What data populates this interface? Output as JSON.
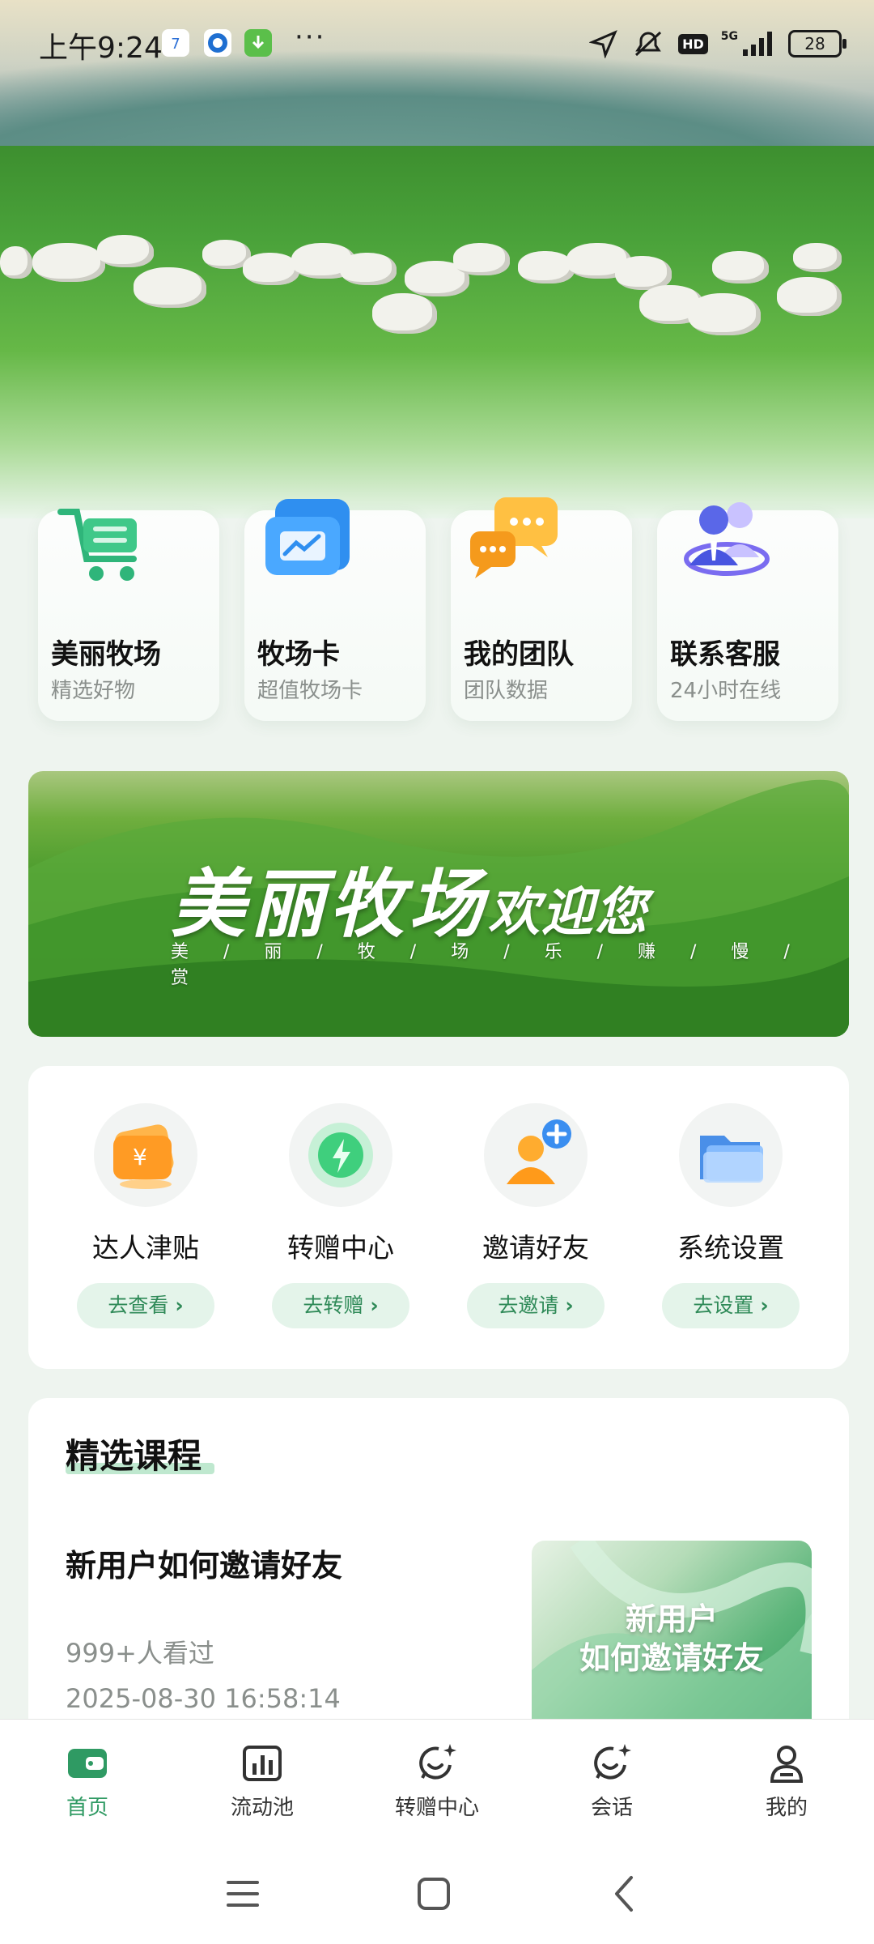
{
  "status_bar": {
    "time": "上午9:24",
    "network": "5G",
    "hd": "HD",
    "battery": "28",
    "more": "···"
  },
  "quick_entries": [
    {
      "title": "美丽牧场",
      "subtitle": "精选好物",
      "icon": "shopping-cart-icon"
    },
    {
      "title": "牧场卡",
      "subtitle": "超值牧场卡",
      "icon": "chart-card-icon"
    },
    {
      "title": "我的团队",
      "subtitle": "团队数据",
      "icon": "chat-bubbles-icon"
    },
    {
      "title": "联系客服",
      "subtitle": "24小时在线",
      "icon": "customer-service-icon"
    }
  ],
  "banner": {
    "headline": "美丽牧场",
    "headline_suffix": "欢迎您",
    "tagline": "美 / 丽 / 牧 / 场 / 乐 / 赚 / 慢 / 赏"
  },
  "tools": [
    {
      "label": "达人津贴",
      "action": "去查看",
      "icon": "wallet-coin-icon"
    },
    {
      "label": "转赠中心",
      "action": "去转赠",
      "icon": "lightning-icon"
    },
    {
      "label": "邀请好友",
      "action": "去邀请",
      "icon": "add-user-icon"
    },
    {
      "label": "系统设置",
      "action": "去设置",
      "icon": "folder-icon"
    }
  ],
  "courses": {
    "section_title": "精选课程",
    "items": [
      {
        "title": "新用户如何邀请好友",
        "views": "999+人看过",
        "date": "2025-08-30 16:58:14",
        "thumb_line1": "新用户",
        "thumb_line2": "如何邀请好友"
      }
    ]
  },
  "tabbar": {
    "active": "首页",
    "items": [
      {
        "label": "首页",
        "icon": "wallet-home-icon"
      },
      {
        "label": "流动池",
        "icon": "bar-chart-icon"
      },
      {
        "label": "转赠中心",
        "icon": "smile-sparkle-icon"
      },
      {
        "label": "会话",
        "icon": "chat-smile-icon"
      },
      {
        "label": "我的",
        "icon": "person-icon"
      }
    ]
  },
  "colors": {
    "accent": "#2f9a63",
    "pill_bg": "#e4f4ea",
    "pill_text": "#2f8a58"
  }
}
